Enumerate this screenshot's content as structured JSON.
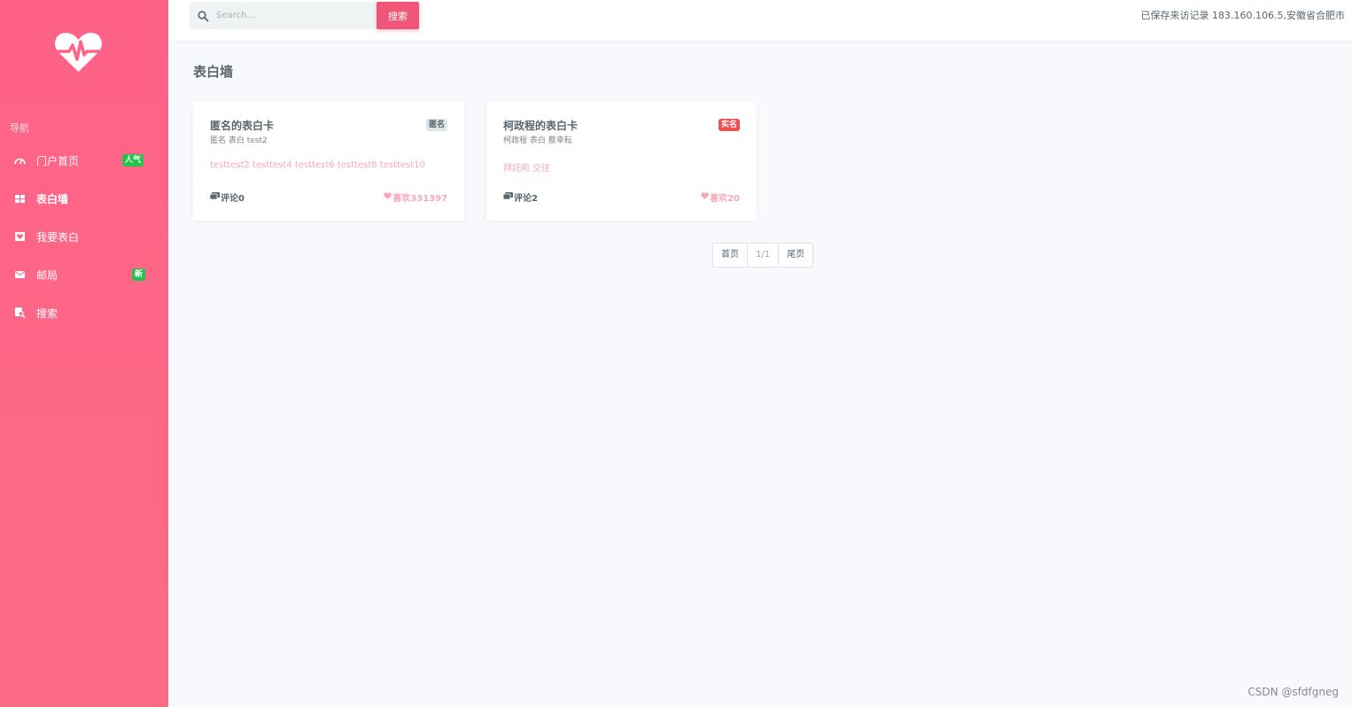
{
  "sidebar": {
    "logo_icon": "heartbeat-icon",
    "heading": "导航",
    "items": [
      {
        "icon": "speedometer-icon",
        "label": "门户首页",
        "badge": "人气",
        "badge_color": "#27c24c"
      },
      {
        "icon": "grid-icon",
        "label": "表白墙",
        "active": true
      },
      {
        "icon": "heart-box-icon",
        "label": "我要表白"
      },
      {
        "icon": "mail-icon",
        "label": "邮局",
        "badge": "新",
        "badge_color": "#27c24c"
      },
      {
        "icon": "search-file-icon",
        "label": "搜索"
      }
    ]
  },
  "header": {
    "search_placeholder": "Search...",
    "search_button": "搜索",
    "visit_record": "已保存来访记录 183.160.106.5,安徽省合肥市"
  },
  "main": {
    "title": "表白墙",
    "cards": [
      {
        "title": "匿名的表白卡",
        "subtitle": "匿名 表白 test2",
        "badge": "匿名",
        "content": "testtest2 testtest4 testtest6 testtest8 testtest10",
        "comments": "评论0",
        "likes": "喜欢331397"
      },
      {
        "title": "柯政程的表白卡",
        "subtitle": "柯政程 表白 蔡幸耘",
        "badge": "实名",
        "content": "拜託啦 交往",
        "comments": "评论2",
        "likes": "喜欢20"
      }
    ],
    "pagination": {
      "first": "首页",
      "current": "1/1",
      "last": "尾页"
    }
  },
  "watermark": "CSDN @sfdfgneg",
  "colors": {
    "sidebar": "#fe6287",
    "accent": "#f05677",
    "badge_green": "#27c24c",
    "badge_red": "#f05050"
  }
}
